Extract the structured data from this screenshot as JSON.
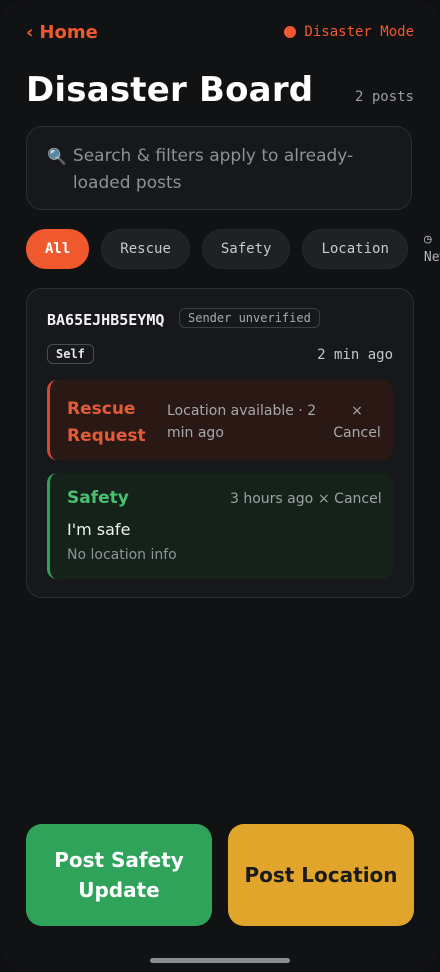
{
  "header": {
    "back_chevron": "‹",
    "back_label": "Home",
    "mode_label": "Disaster Mode",
    "mode_color": "#f0582d"
  },
  "page": {
    "title": "Disaster Board",
    "post_count": "2 posts"
  },
  "search": {
    "icon": "🔍",
    "placeholder": "Search & filters apply to already-loaded posts"
  },
  "filters": {
    "chips": [
      "All",
      "Rescue",
      "Safety",
      "Location"
    ],
    "active": "All",
    "sort_icon": "◷",
    "sort_label": "Newe"
  },
  "post": {
    "sender_id": "BA65EJHB5EYMQ",
    "sender_status": "Sender unverified",
    "self_badge": "Self",
    "time": "2 min ago",
    "entries": [
      {
        "type": "Rescue Request",
        "meta": "Location available · 2 min ago",
        "cancel": "× Cancel",
        "accent": "#d84a2b"
      },
      {
        "type": "Safety",
        "time": "3 hours ago",
        "cancel": "× Cancel",
        "message": "I'm safe",
        "location": "No location info",
        "accent": "#2fa35a"
      }
    ]
  },
  "actions": {
    "post_safety": "Post Safety Update",
    "post_location": "Post Location"
  }
}
